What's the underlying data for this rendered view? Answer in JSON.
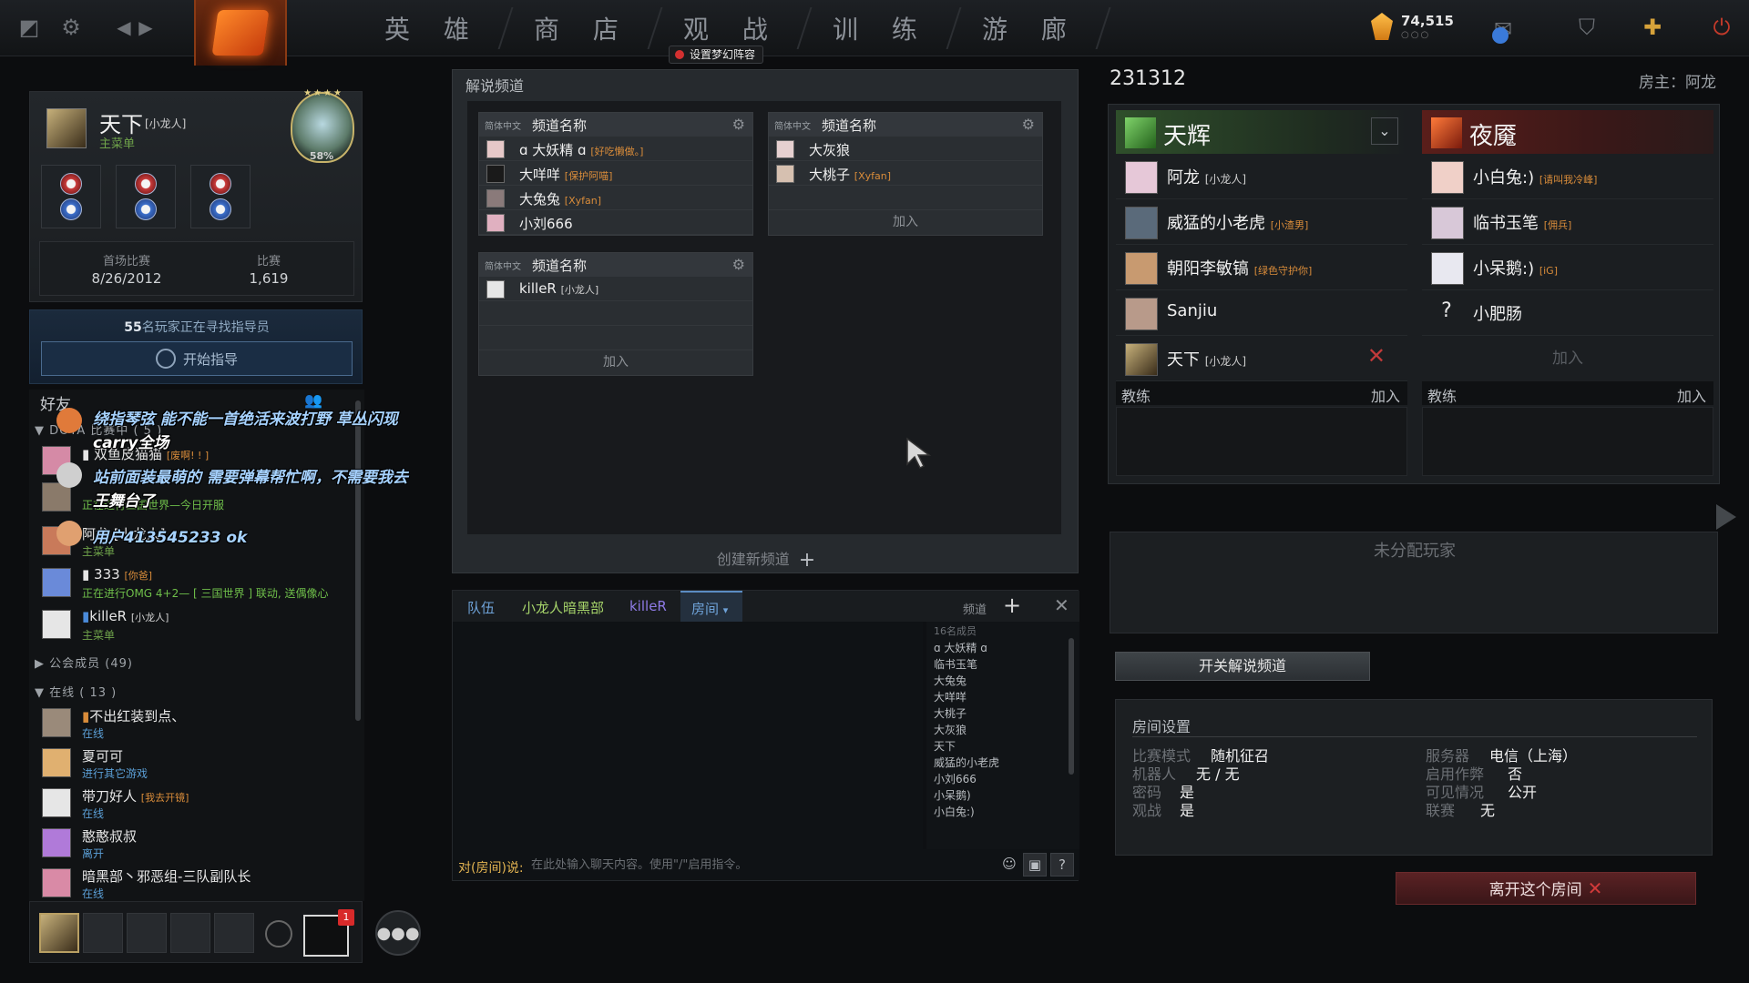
{
  "nav": {
    "tabs": [
      "英 雄",
      "商 店",
      "观 战",
      "训 练",
      "游 廊"
    ],
    "featured_badge": "设置梦幻阵容",
    "shards": "74,515",
    "shards_sub": "○○○"
  },
  "profile": {
    "name": "天下",
    "tag": "[小龙人]",
    "status": "主菜单",
    "rank_stars": "★★★★",
    "rank_percent": "58%",
    "first_match_label": "首场比赛",
    "first_match_value": "8/26/2012",
    "matches_label": "比赛",
    "matches_value": "1,619"
  },
  "coach": {
    "count": "55",
    "text": "名玩家正在寻找指导员",
    "button": "开始指导"
  },
  "friends": {
    "title": "好友",
    "group_playing": "DOTA 比赛中 ( 5 )",
    "playing": [
      {
        "name": "双鱼皮猫猫",
        "tag": "[废啊! ! ]",
        "status": ""
      },
      {
        "name": "正在进行三国世界—今日开服",
        "tag": "",
        "status": ""
      },
      {
        "name": "",
        "tag": "",
        "status": "正在进行三国世界—今日开服"
      },
      {
        "name": "阿龙 [小龙人]",
        "tag": "",
        "status": "主菜单"
      },
      {
        "name": "333",
        "tag": "[你爸]",
        "status": "正在进行OMG 4+2— [ 三国世界 ] 联动, 送偶像心"
      },
      {
        "name": "killeR",
        "tag": "[小龙人]",
        "status": "主菜单"
      }
    ],
    "group_guild": "公会成员 (49)",
    "group_online": "在线 ( 13 )",
    "online": [
      {
        "name": "不出红装到点、",
        "tag": "",
        "status": "在线"
      },
      {
        "name": "夏可可",
        "tag": "",
        "status": "进行其它游戏"
      },
      {
        "name": "带刀好人",
        "tag": "[我去开镜]",
        "status": "在线"
      },
      {
        "name": "憨憨叔叔",
        "tag": "",
        "status": "离开"
      },
      {
        "name": "暗黑部丶邪恶组-三队副队长",
        "tag": "",
        "status": "在线"
      }
    ]
  },
  "danmaku": [
    "绕指琴弦  能不能一首绝活来波打野  草丛闪现",
    "carry全场",
    "站前面装最萌的  需要弹幕帮忙啊，不需要我去",
    "王舞台了",
    "用户413545233  ok"
  ],
  "party": {
    "notifications": "1"
  },
  "channels": {
    "title": "解说频道",
    "list": [
      {
        "lang": "简体中文",
        "name": "频道名称",
        "members": [
          {
            "name": "ɑ 大妖精 ɑ",
            "tag": "[好吃懒做。]"
          },
          {
            "name": "大咩咩",
            "tag": "[保护阿喵]"
          },
          {
            "name": "大兔兔",
            "tag": "[Xyfan]"
          },
          {
            "name": "小刘666",
            "tag": ""
          }
        ]
      },
      {
        "lang": "简体中文",
        "name": "频道名称",
        "members": [
          {
            "name": "大灰狼",
            "tag": ""
          },
          {
            "name": "大桃子",
            "tag": "[Xyfan]"
          }
        ],
        "join": "加入"
      },
      {
        "lang": "简体中文",
        "name": "频道名称",
        "members": [
          {
            "name": "killeR",
            "tag": "[小龙人]"
          }
        ],
        "join": "加入"
      }
    ],
    "create": "创建新频道"
  },
  "chat": {
    "tabs": [
      "队伍",
      "小龙人暗黑部",
      "killeR"
    ],
    "active_tab": "房间",
    "channels_label": "频道",
    "member_count": "16名成员",
    "members": [
      "ɑ 大妖精 ɑ",
      "临书玉笔",
      "大兔兔",
      "大咩咩",
      "大桃子",
      "大灰狼",
      "天下",
      "威猛的小老虎",
      "小刘666",
      "小呆鹅)",
      "小白兔:)"
    ],
    "prefix": "对(房间)说:",
    "placeholder": "在此处输入聊天内容。使用\"/\"启用指令。"
  },
  "lobby": {
    "id": "231312",
    "host": "房主：阿龙",
    "radiant": {
      "name": "天辉",
      "players": [
        {
          "name": "阿龙",
          "tag": "[小龙人]"
        },
        {
          "name": "威猛的小老虎",
          "tag": "[小渣男]"
        },
        {
          "name": "朝阳李敏镐",
          "tag": "[绿色守护你]"
        },
        {
          "name": "Sanjiu",
          "tag": ""
        },
        {
          "name": "天下",
          "tag": "[小龙人]"
        }
      ]
    },
    "dire": {
      "name": "夜魇",
      "players": [
        {
          "name": "小白兔:)",
          "tag": "[请叫我冷峰]"
        },
        {
          "name": "临书玉笔",
          "tag": "[佣兵]"
        },
        {
          "name": "小呆鹅:)",
          "tag": "[iG]"
        },
        {
          "name": "小肥肠",
          "tag": ""
        }
      ],
      "join": "加入"
    },
    "coach_label": "教练",
    "coach_join": "加入",
    "unassigned": "未分配玩家",
    "toggle_commentary": "开关解说频道",
    "leave": "离开这个房间"
  },
  "settings": {
    "title": "房间设置",
    "rows": [
      {
        "k": "比赛模式",
        "v": "随机征召"
      },
      {
        "k": "机器人",
        "v": "无 / 无"
      },
      {
        "k": "密码",
        "v": "是"
      },
      {
        "k": "观战",
        "v": "是"
      },
      {
        "k": "服务器",
        "v": "电信（上海）"
      },
      {
        "k": "启用作弊",
        "v": "否"
      },
      {
        "k": "可见情况",
        "v": "公开"
      },
      {
        "k": "联赛",
        "v": "无"
      }
    ]
  }
}
